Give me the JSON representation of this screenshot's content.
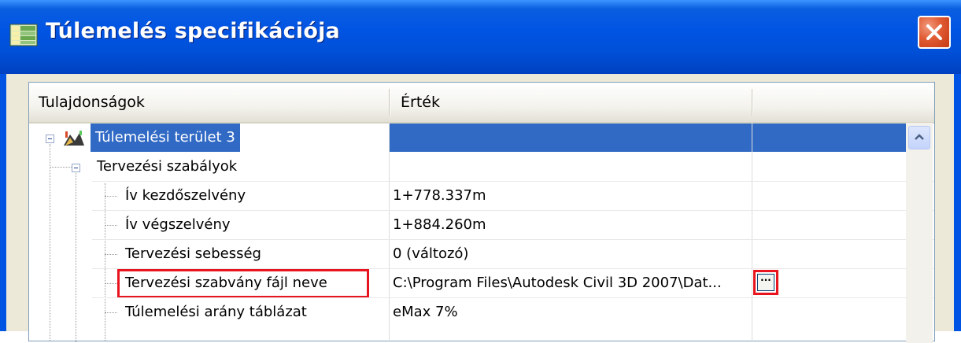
{
  "window": {
    "title": "Túlemelés specifikációja",
    "title_bar_color": "#0054e3",
    "close_color": "#e05a33"
  },
  "grid": {
    "headers": [
      "Tulajdonságok",
      "Érték"
    ],
    "rows": [
      {
        "label": "Túlemelési terület 3",
        "value": "",
        "level": 0,
        "selected": true,
        "icon": "superelevation-region-icon"
      },
      {
        "label": "Tervezési szabályok",
        "value": "",
        "level": 1,
        "selected": false
      },
      {
        "label": "Ív kezdőszelvény",
        "value": "1+778.337m",
        "level": 2
      },
      {
        "label": "Ív végszelvény",
        "value": "1+884.260m",
        "level": 2
      },
      {
        "label": "Tervezési sebesség",
        "value": "0 (változó)",
        "level": 2
      },
      {
        "label": "Tervezési szabvány fájl neve",
        "value": "C:\\Program Files\\Autodesk Civil 3D 2007\\Dat...",
        "level": 2,
        "highlighted": true,
        "has_browse_button": true
      },
      {
        "label": "Túlemelési arány táblázat",
        "value": "eMax 7%",
        "level": 2
      }
    ],
    "browse_button_label": "···",
    "selection_color": "#316ac5",
    "highlight_color": "#e8141e"
  }
}
